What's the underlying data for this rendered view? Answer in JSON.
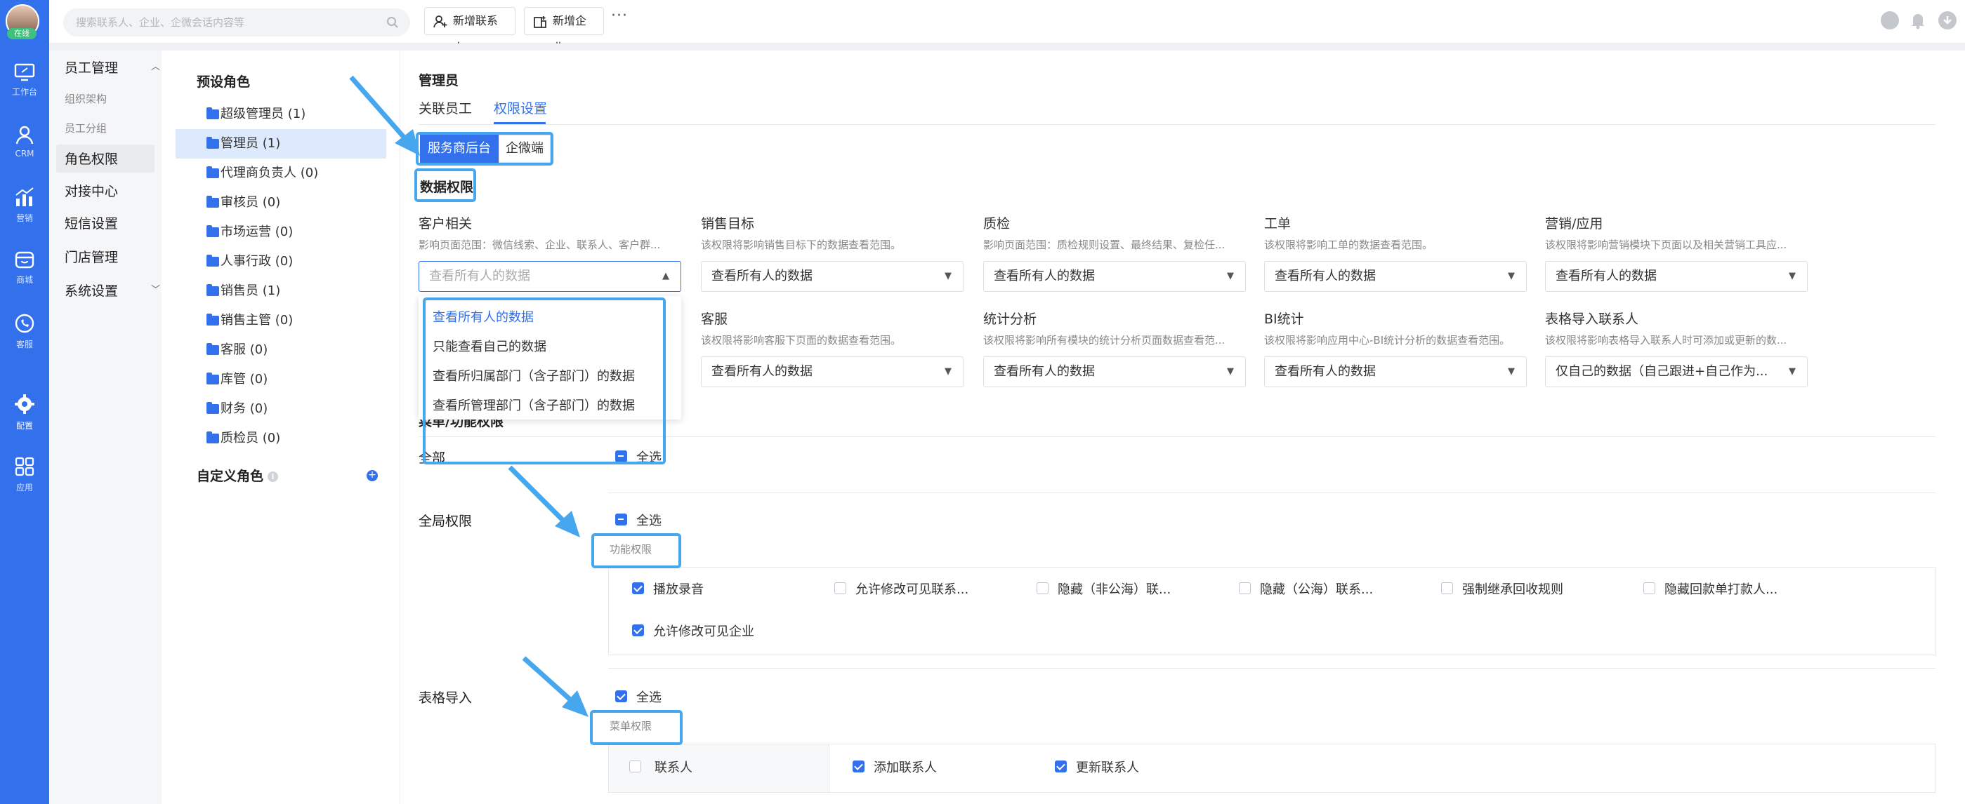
{
  "rail": {
    "online": "在线",
    "items": [
      {
        "label": "工作台",
        "icon": "monitor-icon"
      },
      {
        "label": "CRM",
        "icon": "person-icon"
      },
      {
        "label": "营销",
        "icon": "chart-icon"
      },
      {
        "label": "商城",
        "icon": "store-icon"
      },
      {
        "label": "客服",
        "icon": "headset-icon"
      },
      {
        "label": "配置",
        "icon": "gear-icon"
      },
      {
        "label": "应用",
        "icon": "apps-icon"
      }
    ]
  },
  "topbar": {
    "search_placeholder": "搜索联系人、企业、企微会话内容等",
    "add_contact": "新增联系人",
    "add_company": "新增企业",
    "more": "···"
  },
  "menu": {
    "employee": "员工管理",
    "org": "组织架构",
    "group": "员工分组",
    "role": "角色权限",
    "docking": "对接中心",
    "sms": "短信设置",
    "store": "门店管理",
    "system": "系统设置"
  },
  "roles": {
    "preset_title": "预设角色",
    "items": [
      {
        "name": "超级管理员",
        "count": "(1)"
      },
      {
        "name": "管理员",
        "count": "(1)"
      },
      {
        "name": "代理商负责人",
        "count": "(0)"
      },
      {
        "name": "审核员",
        "count": "(0)"
      },
      {
        "name": "市场运营",
        "count": "(0)"
      },
      {
        "name": "人事行政",
        "count": "(0)"
      },
      {
        "name": "销售员",
        "count": "(1)"
      },
      {
        "name": "销售主管",
        "count": "(0)"
      },
      {
        "name": "客服",
        "count": "(0)"
      },
      {
        "name": "库管",
        "count": "(0)"
      },
      {
        "name": "财务",
        "count": "(0)"
      },
      {
        "name": "质检员",
        "count": "(0)"
      }
    ],
    "custom_title": "自定义角色",
    "info": "i",
    "plus": "+"
  },
  "content": {
    "title": "管理员",
    "tabs": [
      "关联员工",
      "权限设置"
    ],
    "seg": [
      "服务商后台",
      "企微端"
    ],
    "data_perm": "数据权限",
    "categories_row1": [
      {
        "name": "客户相关",
        "desc": "影响页面范围：微信线索、企业、联系人、客户群...",
        "value": "查看所有人的数据"
      },
      {
        "name": "销售目标",
        "desc": "该权限将影响销售目标下的数据查看范围。",
        "value": "查看所有人的数据"
      },
      {
        "name": "质检",
        "desc": "影响页面范围：质检规则设置、最终结果、复检任...",
        "value": "查看所有人的数据"
      },
      {
        "name": "工单",
        "desc": "该权限将影响工单的数据查看范围。",
        "value": "查看所有人的数据"
      },
      {
        "name": "营销/应用",
        "desc": "该权限将影响营销模块下页面以及相关营销工具应...",
        "value": "查看所有人的数据"
      }
    ],
    "categories_row2": [
      {
        "name": "客服",
        "desc": "该权限将影响客服下页面的数据查看范围。",
        "value": "查看所有人的数据"
      },
      {
        "name": "统计分析",
        "desc": "该权限将影响所有模块的统计分析页面数据查看范...",
        "value": "查看所有人的数据"
      },
      {
        "name": "BI统计",
        "desc": "该权限将影响应用中心-BI统计分析的数据查看范围。",
        "value": "查看所有人的数据"
      },
      {
        "name": "表格导入联系人",
        "desc": "该权限将影响表格导入联系人时可添加或更新的数...",
        "value": "仅自己的数据（自己跟进+自己作为..."
      }
    ],
    "dropdown": [
      "查看所有人的数据",
      "只能查看自己的数据",
      "查看所归属部门（含子部门）的数据",
      "查看所管理部门（含子部门）的数据"
    ],
    "menu_perm": "菜单/功能权限",
    "all": "全部",
    "select_all": "全选",
    "global_perm": "全局权限",
    "func_perm": "功能权限",
    "global_items": [
      {
        "label": "播放录音",
        "checked": true
      },
      {
        "label": "允许修改可见联系...",
        "checked": false
      },
      {
        "label": "隐藏（非公海）联...",
        "checked": false
      },
      {
        "label": "隐藏（公海）联系...",
        "checked": false
      },
      {
        "label": "强制继承回收规则",
        "checked": false
      },
      {
        "label": "隐藏回款单打款人...",
        "checked": false
      },
      {
        "label": "允许修改可见企业",
        "checked": true
      }
    ],
    "table_import": "表格导入",
    "menu_sub_perm": "菜单权限",
    "import_row": {
      "group": "联系人",
      "items": [
        "添加联系人",
        "更新联系人"
      ]
    }
  }
}
